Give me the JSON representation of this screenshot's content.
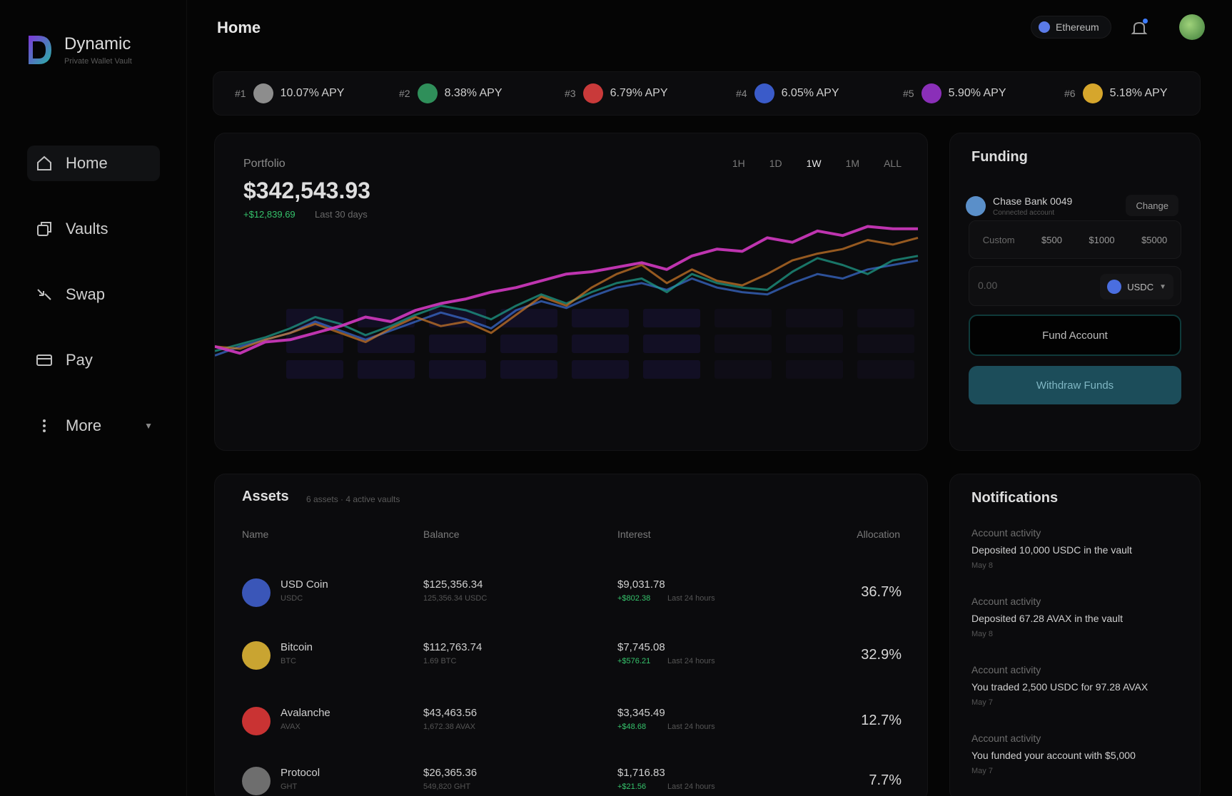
{
  "brand": {
    "name": "Dynamic",
    "tagline": "Private Wallet Vault"
  },
  "sidebar": {
    "items": [
      {
        "label": "Home",
        "icon": "home-icon",
        "active": true
      },
      {
        "label": "Vaults",
        "icon": "vault-icon",
        "active": false
      },
      {
        "label": "Swap",
        "icon": "swap-icon",
        "active": false
      },
      {
        "label": "Pay",
        "icon": "card-icon",
        "active": false
      },
      {
        "label": "More",
        "icon": "more-icon",
        "active": false
      }
    ]
  },
  "header": {
    "title": "Home",
    "network": "Ethereum"
  },
  "ticker": [
    {
      "rank": "#1",
      "apy": "10.07% APY",
      "color": "#8d8d8d"
    },
    {
      "rank": "#2",
      "apy": "8.38% APY",
      "color": "#2f8f5a"
    },
    {
      "rank": "#3",
      "apy": "6.79% APY",
      "color": "#c93a3a"
    },
    {
      "rank": "#4",
      "apy": "6.05% APY",
      "color": "#3a5bc9"
    },
    {
      "rank": "#5",
      "apy": "5.90% APY",
      "color": "#8a2fb8"
    },
    {
      "rank": "#6",
      "apy": "5.18% APY",
      "color": "#d6a62c"
    }
  ],
  "portfolio": {
    "label": "Portfolio",
    "value": "$342,543.93",
    "change": "+$12,839.69",
    "period": "Last 30 days",
    "ranges": [
      "1H",
      "1D",
      "1W",
      "1M",
      "ALL"
    ],
    "selected_range": "1W"
  },
  "chart_data": {
    "type": "line",
    "series": [
      {
        "values": [
          52,
          49,
          54,
          55,
          58,
          61,
          65,
          63,
          68,
          71,
          73,
          76,
          78,
          81,
          84,
          85,
          87,
          89,
          86,
          92,
          95,
          94,
          100,
          98,
          103,
          101,
          105,
          104,
          104
        ],
        "color": "#c837b8"
      },
      {
        "values": [
          52,
          51,
          55,
          58,
          62,
          58,
          54,
          60,
          65,
          61,
          63,
          58,
          66,
          74,
          70,
          78,
          84,
          88,
          80,
          86,
          81,
          79,
          84,
          90,
          93,
          95,
          99,
          97,
          100
        ],
        "color": "#d07b2a"
      },
      {
        "values": [
          50,
          53,
          56,
          60,
          65,
          62,
          57,
          61,
          66,
          70,
          68,
          64,
          70,
          75,
          71,
          76,
          80,
          82,
          76,
          84,
          80,
          78,
          77,
          85,
          91,
          88,
          84,
          90,
          92
        ],
        "color": "#1fa38e"
      },
      {
        "values": [
          48,
          52,
          55,
          58,
          63,
          59,
          55,
          59,
          63,
          67,
          64,
          60,
          68,
          72,
          69,
          74,
          78,
          80,
          77,
          82,
          78,
          76,
          75,
          80,
          84,
          82,
          86,
          88,
          90
        ],
        "color": "#3c6fd6"
      }
    ],
    "bar_background": true
  },
  "funding": {
    "title": "Funding",
    "bank_name": "Chase Bank 0049",
    "bank_sub": "Connected account",
    "change_label": "Change",
    "amounts": [
      "Custom",
      "$500",
      "$1000",
      "$5000"
    ],
    "input_placeholder": "0.00",
    "token": "USDC",
    "fund_label": "Fund Account",
    "withdraw_label": "Withdraw Funds"
  },
  "assets": {
    "title": "Assets",
    "meta": "6 assets · 4 active vaults",
    "columns": [
      "Name",
      "Balance",
      "Interest",
      "Allocation"
    ],
    "rows": [
      {
        "name": "USD Coin",
        "symbol": "USDC",
        "balance": "$125,356.34",
        "balance_sub": "125,356.34 USDC",
        "interest": "$9,031.78",
        "interest_change": "+$802.38",
        "interest_period": "Last 24 hours",
        "allocation": "36.7%",
        "color": "#3a56b8"
      },
      {
        "name": "Bitcoin",
        "symbol": "BTC",
        "balance": "$112,763.74",
        "balance_sub": "1.69 BTC",
        "interest": "$7,745.08",
        "interest_change": "+$576.21",
        "interest_period": "Last 24 hours",
        "allocation": "32.9%",
        "color": "#c9a431"
      },
      {
        "name": "Avalanche",
        "symbol": "AVAX",
        "balance": "$43,463.56",
        "balance_sub": "1,672.38 AVAX",
        "interest": "$3,345.49",
        "interest_change": "+$48.68",
        "interest_period": "Last 24 hours",
        "allocation": "12.7%",
        "color": "#c93333"
      },
      {
        "name": "Protocol",
        "symbol": "GHT",
        "balance": "$26,365.36",
        "balance_sub": "549,820 GHT",
        "interest": "$1,716.83",
        "interest_change": "+$21.56",
        "interest_period": "Last 24 hours",
        "allocation": "7.7%",
        "color": "#6e6e6e"
      }
    ]
  },
  "notifications": {
    "title": "Notifications",
    "items": [
      {
        "type": "Account activity",
        "message": "Deposited 10,000 USDC in the vault",
        "date": "May 8"
      },
      {
        "type": "Account activity",
        "message": "Deposited 67.28 AVAX in the vault",
        "date": "May 8"
      },
      {
        "type": "Account activity",
        "message": "You traded 2,500 USDC for 97.28 AVAX",
        "date": "May 7"
      },
      {
        "type": "Account activity",
        "message": "You funded your account with $5,000",
        "date": "May 7"
      }
    ]
  }
}
